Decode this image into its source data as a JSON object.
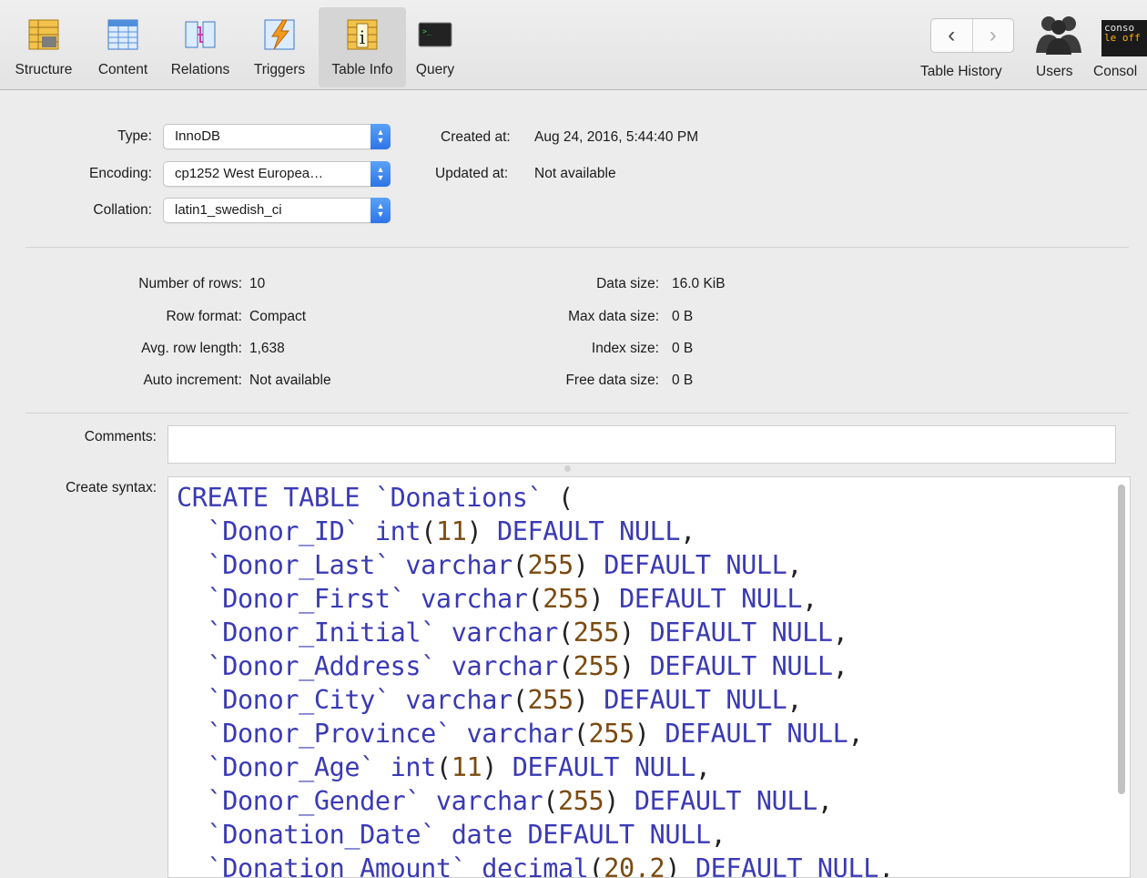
{
  "toolbar": {
    "tabs": [
      {
        "label": "Structure",
        "icon": "structure-icon"
      },
      {
        "label": "Content",
        "icon": "content-icon"
      },
      {
        "label": "Relations",
        "icon": "relations-icon"
      },
      {
        "label": "Triggers",
        "icon": "triggers-icon"
      },
      {
        "label": "Table Info",
        "icon": "table-info-icon",
        "active": true
      },
      {
        "label": "Query",
        "icon": "query-icon"
      }
    ],
    "table_history_label": "Table History",
    "users_label": "Users",
    "console_label": "Consol",
    "console_icon_text": [
      "conso",
      "le off"
    ]
  },
  "table_props": {
    "type_label": "Type:",
    "type_value": "InnoDB",
    "encoding_label": "Encoding:",
    "encoding_value": "cp1252 West Europea…",
    "collation_label": "Collation:",
    "collation_value": "latin1_swedish_ci",
    "created_label": "Created at:",
    "created_value": "Aug 24, 2016, 5:44:40 PM",
    "updated_label": "Updated at:",
    "updated_value": "Not available"
  },
  "stats": {
    "rows_label": "Number of rows:",
    "rows_value": "10",
    "row_format_label": "Row format:",
    "row_format_value": "Compact",
    "avg_row_label": "Avg. row length:",
    "avg_row_value": "1,638",
    "auto_inc_label": "Auto increment:",
    "auto_inc_value": "Not available",
    "data_size_label": "Data size:",
    "data_size_value": "16.0 KiB",
    "max_data_label": "Max data size:",
    "max_data_value": "0 B",
    "index_size_label": "Index size:",
    "index_size_value": "0 B",
    "free_data_label": "Free data size:",
    "free_data_value": "0 B"
  },
  "comments": {
    "label": "Comments:",
    "value": ""
  },
  "create_syntax": {
    "label": "Create syntax:",
    "header": [
      "CREATE TABLE",
      "`Donations`",
      "("
    ],
    "lines": [
      {
        "col": "`Donor_ID`",
        "type": "int",
        "size": "11",
        "rest": "DEFAULT NULL"
      },
      {
        "col": "`Donor_Last`",
        "type": "varchar",
        "size": "255",
        "rest": "DEFAULT NULL"
      },
      {
        "col": "`Donor_First`",
        "type": "varchar",
        "size": "255",
        "rest": "DEFAULT NULL"
      },
      {
        "col": "`Donor_Initial`",
        "type": "varchar",
        "size": "255",
        "rest": "DEFAULT NULL"
      },
      {
        "col": "`Donor_Address`",
        "type": "varchar",
        "size": "255",
        "rest": "DEFAULT NULL"
      },
      {
        "col": "`Donor_City`",
        "type": "varchar",
        "size": "255",
        "rest": "DEFAULT NULL"
      },
      {
        "col": "`Donor_Province`",
        "type": "varchar",
        "size": "255",
        "rest": "DEFAULT NULL"
      },
      {
        "col": "`Donor_Age`",
        "type": "int",
        "size": "11",
        "rest": "DEFAULT NULL"
      },
      {
        "col": "`Donor_Gender`",
        "type": "varchar",
        "size": "255",
        "rest": "DEFAULT NULL"
      },
      {
        "col": "`Donation_Date`",
        "type": "date",
        "size": "",
        "rest": "DEFAULT NULL"
      },
      {
        "col": "`Donation_Amount`",
        "type": "decimal",
        "size": "20,2",
        "rest": "DEFAULT NULL"
      }
    ]
  },
  "colors": {
    "keyword": "#3a3ab5",
    "number": "#7a4a10",
    "accent": "#2d75e8"
  }
}
